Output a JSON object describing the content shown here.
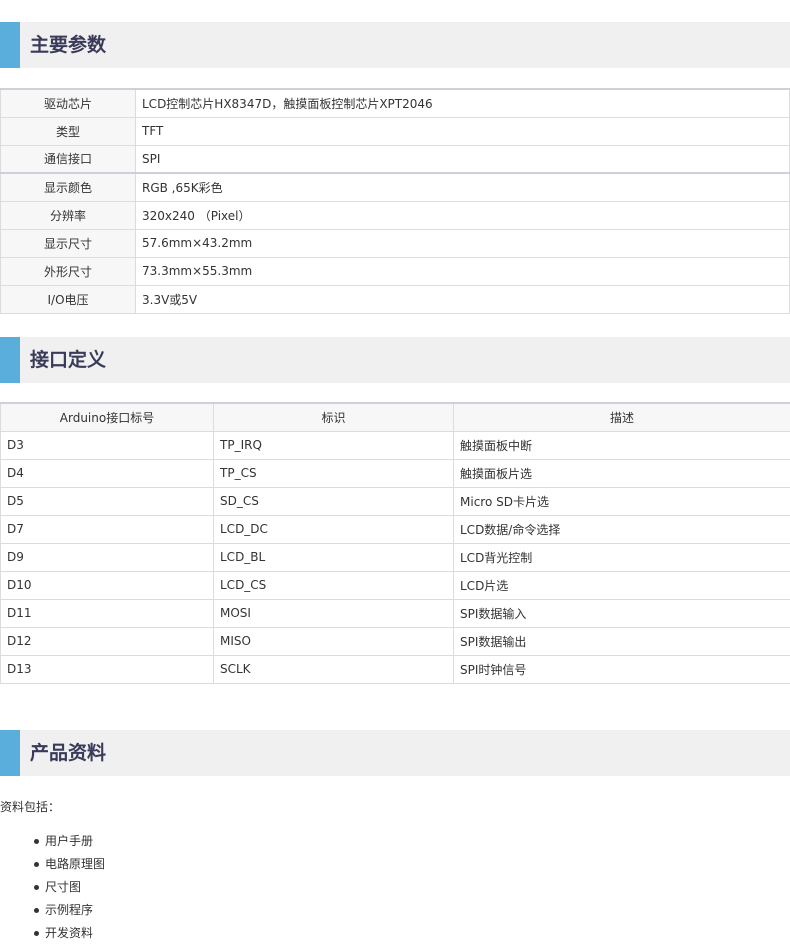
{
  "sections": {
    "params_title": "主要参数",
    "interface_title": "接口定义",
    "resources_title": "产品资料"
  },
  "params": [
    {
      "key": "驱动芯片",
      "value": "LCD控制芯片HX8347D，触摸面板控制芯片XPT2046"
    },
    {
      "key": "类型",
      "value": "TFT"
    },
    {
      "key": "通信接口",
      "value": "SPI"
    },
    {
      "key": "显示颜色",
      "value": "RGB ,65K彩色"
    },
    {
      "key": "分辨率",
      "value": "320x240 （Pixel）"
    },
    {
      "key": "显示尺寸",
      "value": "57.6mm×43.2mm"
    },
    {
      "key": "外形尺寸",
      "value": "73.3mm×55.3mm"
    },
    {
      "key": "I/O电压",
      "value": "3.3V或5V"
    }
  ],
  "interface": {
    "headers": [
      "Arduino接口标号",
      "标识",
      "描述"
    ],
    "rows": [
      [
        "D3",
        "TP_IRQ",
        "触摸面板中断"
      ],
      [
        "D4",
        "TP_CS",
        "触摸面板片选"
      ],
      [
        "D5",
        "SD_CS",
        "Micro SD卡片选"
      ],
      [
        "D7",
        "LCD_DC",
        "LCD数据/命令选择"
      ],
      [
        "D9",
        "LCD_BL",
        "LCD背光控制"
      ],
      [
        "D10",
        "LCD_CS",
        "LCD片选"
      ],
      [
        "D11",
        "MOSI",
        "SPI数据输入"
      ],
      [
        "D12",
        "MISO",
        "SPI数据输出"
      ],
      [
        "D13",
        "SCLK",
        "SPI时钟信号"
      ]
    ]
  },
  "resources": {
    "intro": "资料包括：",
    "items": [
      "用户手册",
      "电路原理图",
      "尺寸图",
      "示例程序",
      "开发资料"
    ]
  },
  "colors": {
    "accent_bar": "#5aaedc",
    "header_bg": "#f0f0f0",
    "title_text": "#3a3a5a"
  }
}
